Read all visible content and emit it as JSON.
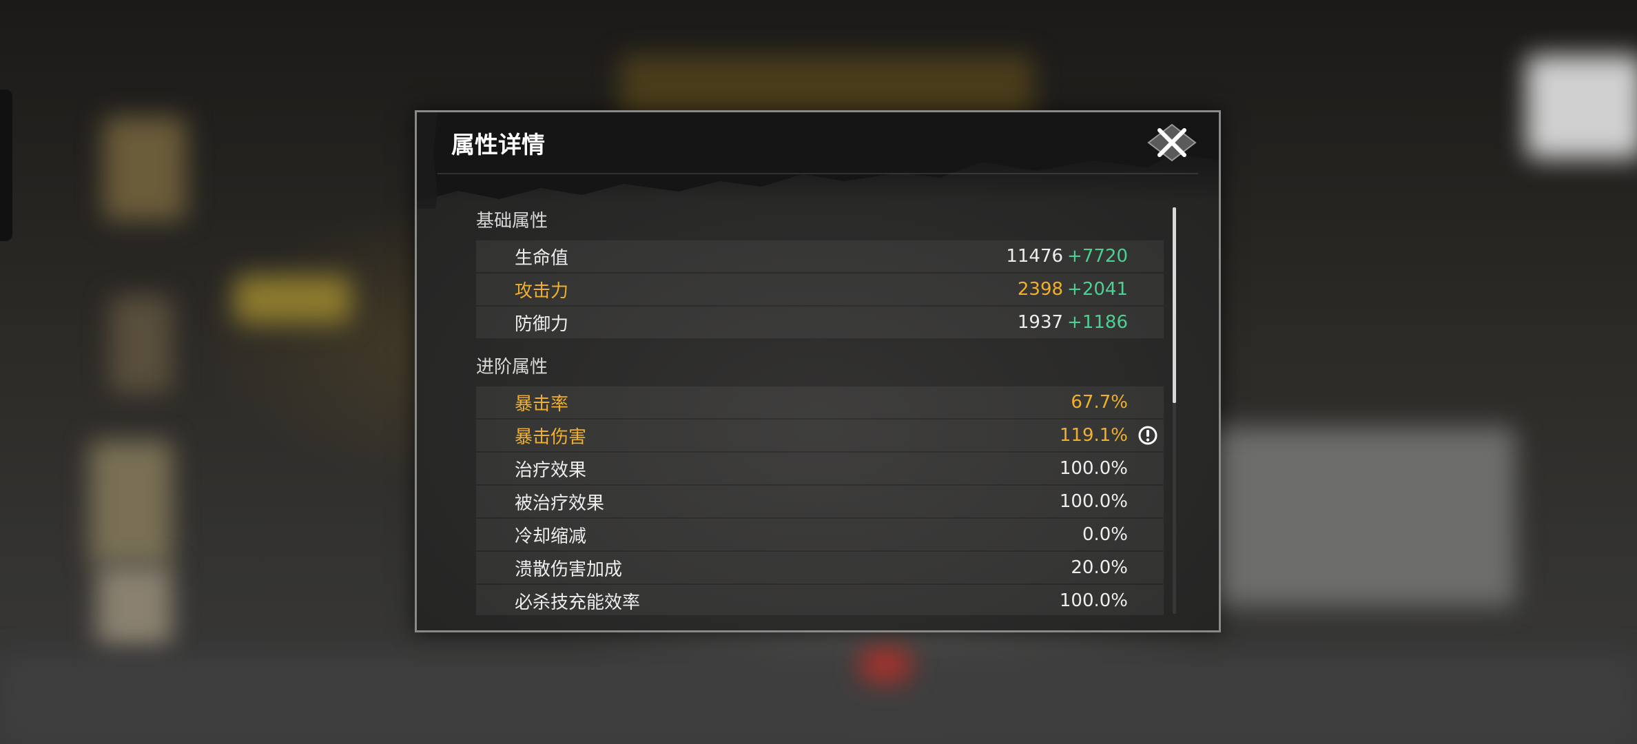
{
  "dialog": {
    "title": "属性详情",
    "close_icon": "close-x-icon"
  },
  "basic": {
    "title": "基础属性",
    "rows": [
      {
        "name": "生命值",
        "value": "11476",
        "bonus": "+7720",
        "highlight": false
      },
      {
        "name": "攻击力",
        "value": "2398",
        "bonus": "+2041",
        "highlight": true
      },
      {
        "name": "防御力",
        "value": "1937",
        "bonus": "+1186",
        "highlight": false
      }
    ]
  },
  "advanced": {
    "title": "进阶属性",
    "rows": [
      {
        "name": "暴击率",
        "value": "67.7%",
        "highlight": true
      },
      {
        "name": "暴击伤害",
        "value": "119.1%",
        "highlight": true,
        "info_icon": "exclamation-circle-icon"
      },
      {
        "name": "治疗效果",
        "value": "100.0%",
        "highlight": false
      },
      {
        "name": "被治疗效果",
        "value": "100.0%",
        "highlight": false
      },
      {
        "name": "冷却缩减",
        "value": "0.0%",
        "highlight": false
      },
      {
        "name": "溃散伤害加成",
        "value": "20.0%",
        "highlight": false
      },
      {
        "name": "必杀技充能效率",
        "value": "100.0%",
        "highlight": false
      }
    ]
  },
  "colors": {
    "highlight": "#f0b02d",
    "bonus": "#4fcf92",
    "text": "#eeeeee"
  }
}
